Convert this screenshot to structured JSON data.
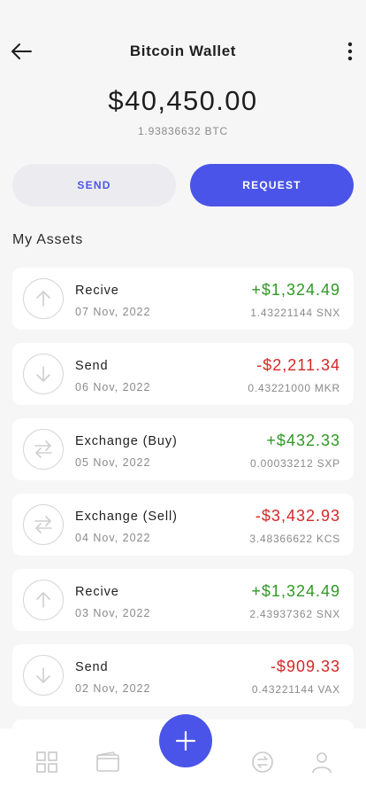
{
  "header": {
    "title": "Bitcoin Wallet",
    "back_icon": "arrow-left-icon",
    "more_icon": "more-vertical-icon"
  },
  "balance": {
    "amount": "$40,450.00",
    "btc": "1.93836632 BTC"
  },
  "actions": {
    "send_label": "SEND",
    "request_label": "REQUEST"
  },
  "section_title": "My Assets",
  "colors": {
    "accent": "#4a54e8",
    "positive": "#2e9a23",
    "negative": "#d42828"
  },
  "assets": [
    {
      "title": "Recive",
      "date": "07 Nov, 2022",
      "amount": "+$1,324.49",
      "crypto": "1.43221144 SNX",
      "direction": "positive",
      "icon": "arrow-up-icon"
    },
    {
      "title": "Send",
      "date": "06 Nov, 2022",
      "amount": "-$2,211.34",
      "crypto": "0.43221000 MKR",
      "direction": "negative",
      "icon": "arrow-down-icon"
    },
    {
      "title": "Exchange (Buy)",
      "date": "05 Nov, 2022",
      "amount": "+$432.33",
      "crypto": "0.00033212 SXP",
      "direction": "positive",
      "icon": "exchange-icon"
    },
    {
      "title": "Exchange (Sell)",
      "date": "04 Nov, 2022",
      "amount": "-$3,432.93",
      "crypto": "3.48366622 KCS",
      "direction": "negative",
      "icon": "exchange-icon"
    },
    {
      "title": "Recive",
      "date": "03 Nov, 2022",
      "amount": "+$1,324.49",
      "crypto": "2.43937362 SNX",
      "direction": "positive",
      "icon": "arrow-up-icon"
    },
    {
      "title": "Send",
      "date": "02 Nov, 2022",
      "amount": "-$909.33",
      "crypto": "0.43221144 VAX",
      "direction": "negative",
      "icon": "arrow-down-icon"
    }
  ],
  "nav": {
    "items": [
      "grid-icon",
      "wallet-icon",
      "add-icon",
      "exchange-icon",
      "profile-icon"
    ]
  }
}
